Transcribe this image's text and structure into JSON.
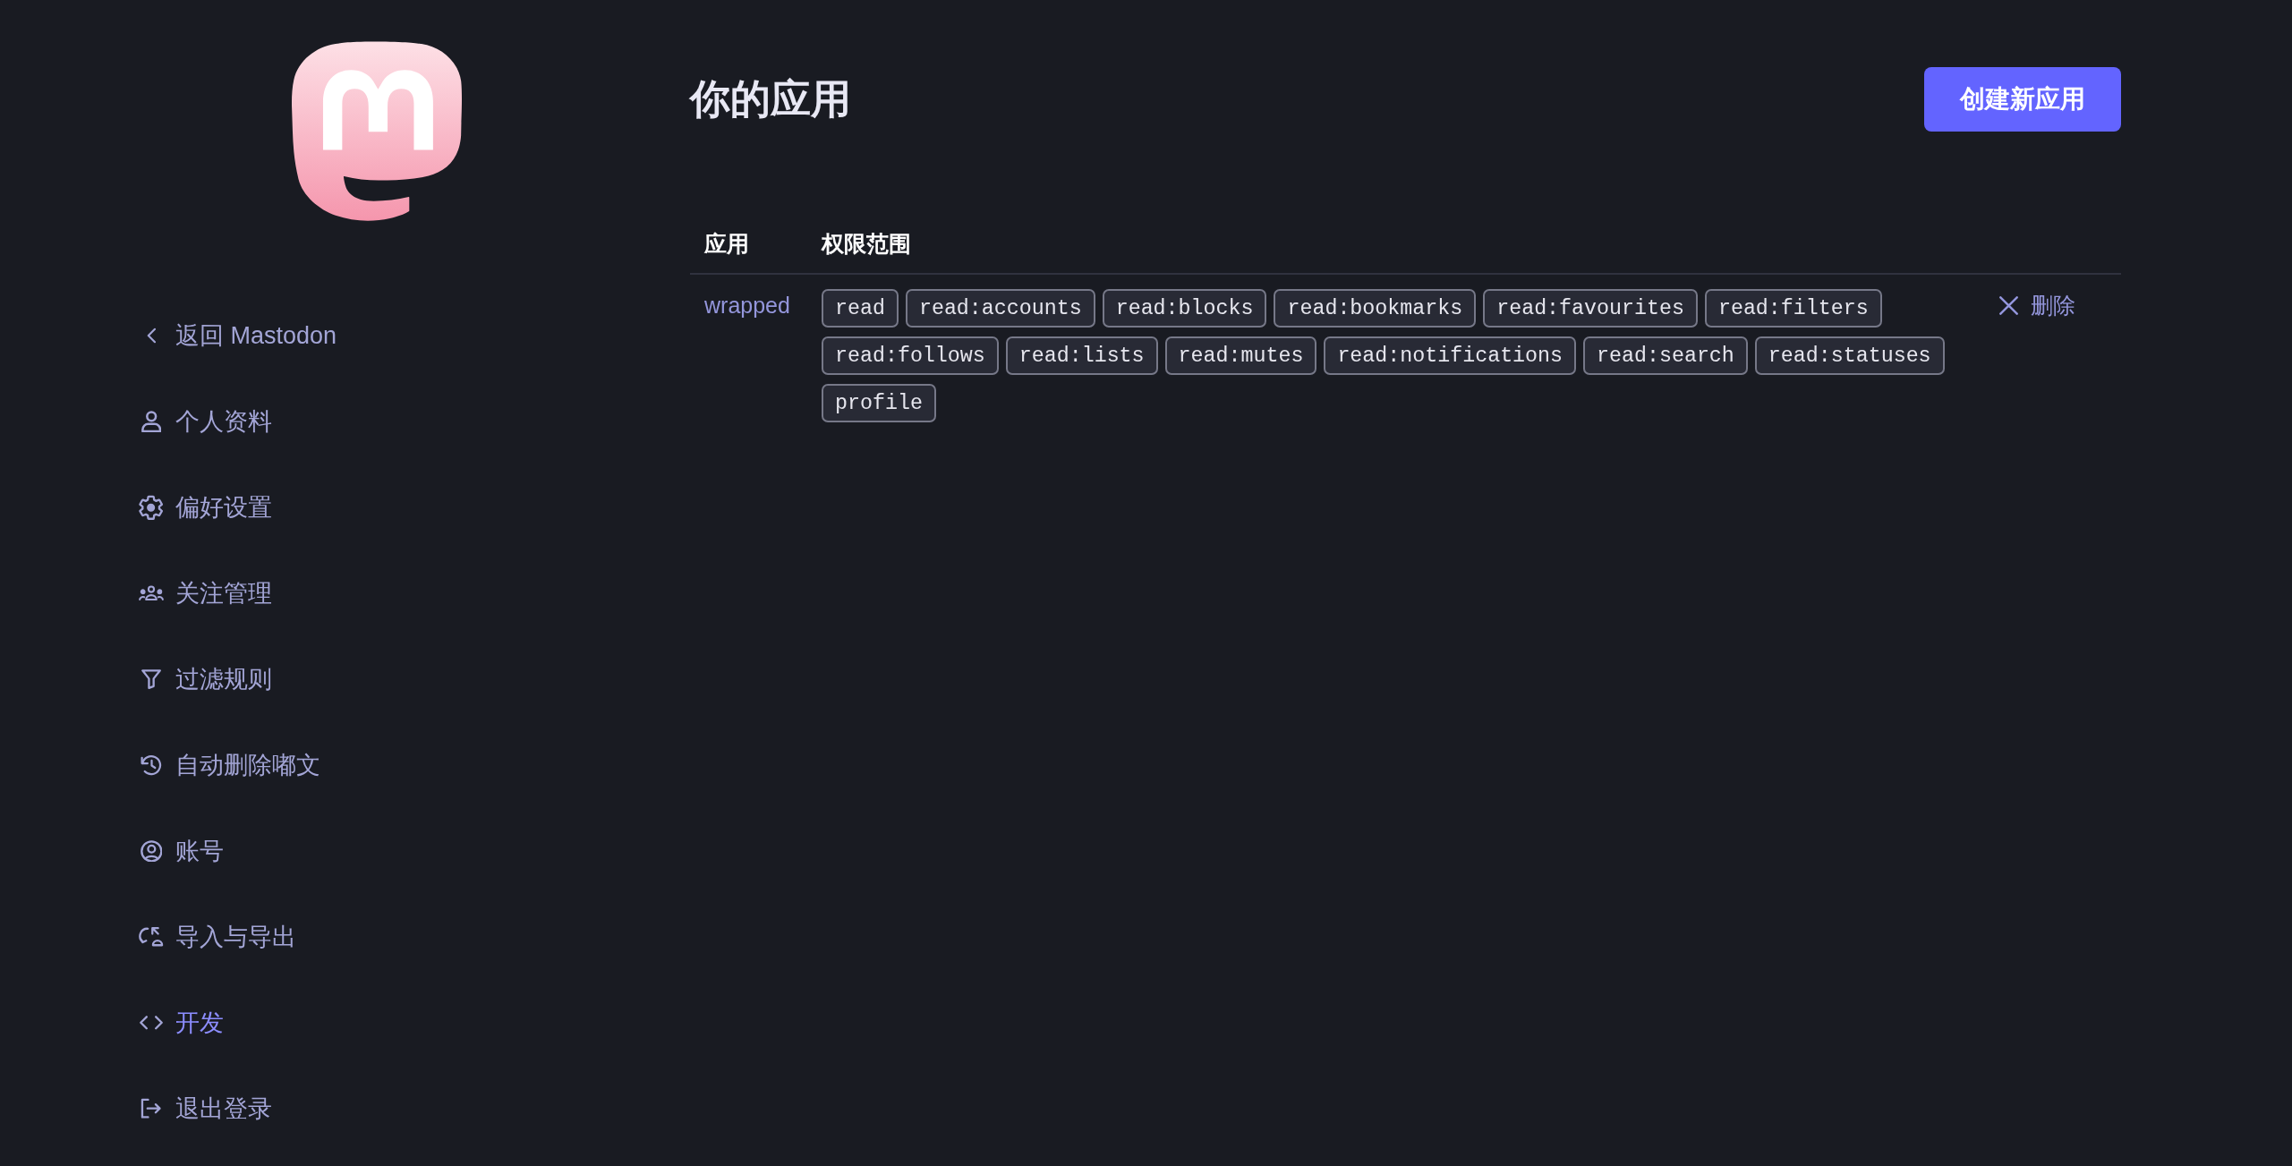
{
  "sidebar": {
    "items": [
      {
        "label": "返回 Mastodon",
        "selected": false
      },
      {
        "label": "个人资料",
        "selected": false
      },
      {
        "label": "偏好设置",
        "selected": false
      },
      {
        "label": "关注管理",
        "selected": false
      },
      {
        "label": "过滤规则",
        "selected": false
      },
      {
        "label": "自动删除嘟文",
        "selected": false
      },
      {
        "label": "账号",
        "selected": false
      },
      {
        "label": "导入与导出",
        "selected": false
      },
      {
        "label": "开发",
        "selected": true
      },
      {
        "label": "退出登录",
        "selected": false
      }
    ]
  },
  "header": {
    "title": "你的应用",
    "button": "创建新应用"
  },
  "table": {
    "columns": [
      "应用",
      "权限范围"
    ],
    "rows": [
      {
        "app": "wrapped",
        "scopes": [
          "read",
          "read:accounts",
          "read:blocks",
          "read:bookmarks",
          "read:favourites",
          "read:filters",
          "read:follows",
          "read:lists",
          "read:mutes",
          "read:notifications",
          "read:search",
          "read:statuses",
          "profile"
        ],
        "action": "删除"
      }
    ]
  }
}
